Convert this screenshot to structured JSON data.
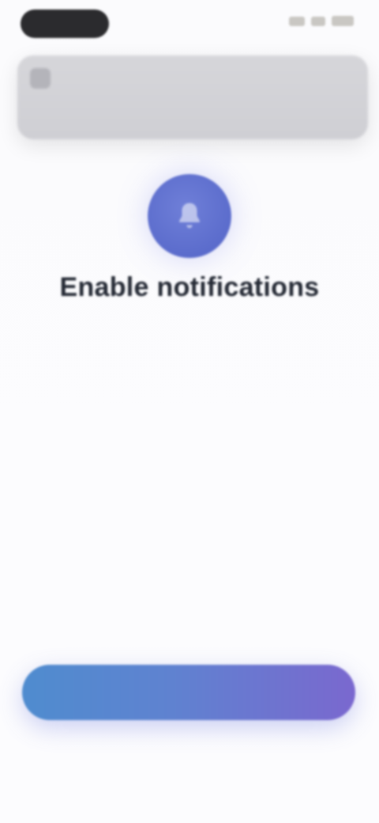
{
  "status_bar": {
    "time": "",
    "icons": [
      "signal-icon",
      "wifi-icon",
      "battery-icon"
    ]
  },
  "notification_preview": {
    "app_name": "",
    "time": "",
    "title": "",
    "body": ""
  },
  "hero": {
    "icon": "bell-icon",
    "icon_color": "#5f6fd0",
    "title": "Enable notifications",
    "subtitle": ""
  },
  "actions": {
    "primary_label": "",
    "secondary_label": ""
  },
  "colors": {
    "accent_start": "#4f8ccf",
    "accent_end": "#7a68cf",
    "background": "#fbfbfd"
  }
}
